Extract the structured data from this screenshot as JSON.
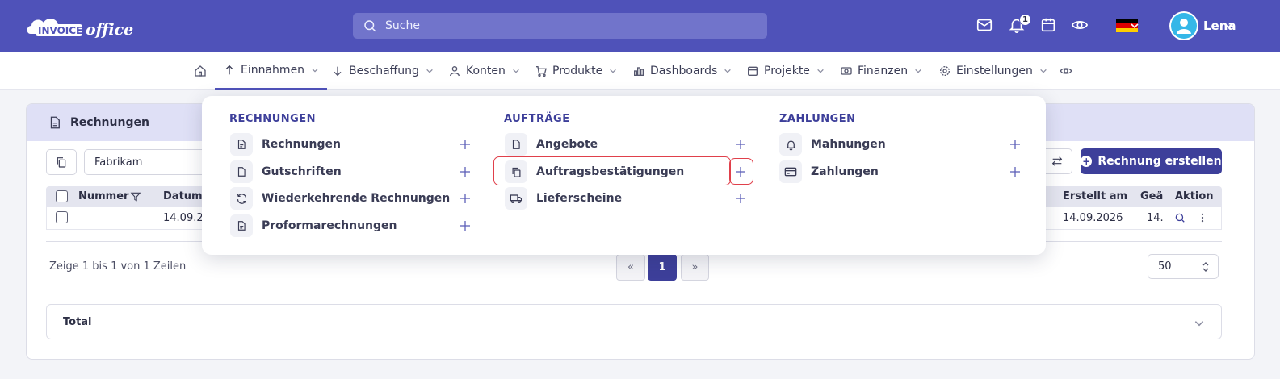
{
  "app": {
    "logo_left": "INVOICE",
    "logo_right": "office"
  },
  "search": {
    "placeholder": "Suche"
  },
  "header": {
    "notification_count": "1",
    "user_name": "Lena",
    "colors": {
      "primary": "#4f52b9",
      "accent": "#3d3f9a",
      "highlight": "#e0404b"
    }
  },
  "nav": {
    "items": [
      {
        "label": "Einnahmen",
        "icon": "arrow-up-icon"
      },
      {
        "label": "Beschaffung",
        "icon": "arrow-down-icon"
      },
      {
        "label": "Konten",
        "icon": "user-icon"
      },
      {
        "label": "Produkte",
        "icon": "cart-icon"
      },
      {
        "label": "Dashboards",
        "icon": "bar-chart-icon"
      },
      {
        "label": "Projekte",
        "icon": "calendar-icon"
      },
      {
        "label": "Finanzen",
        "icon": "banknote-icon"
      },
      {
        "label": "Einstellungen",
        "icon": "gear-icon"
      }
    ]
  },
  "card": {
    "title": "Rechnungen",
    "filter_value": "Fabrikam",
    "create_button": "Rechnung erstellen"
  },
  "table": {
    "columns": {
      "number": "Nummer",
      "date": "Datum",
      "created": "Erstellt am",
      "due": "Geä",
      "action": "Aktion"
    },
    "rows": [
      {
        "date": "14.09.2",
        "created": "14.09.2026",
        "due": "14."
      }
    ]
  },
  "footer": {
    "summary": "Zeige 1 bis 1 von 1 Zeilen",
    "prev": "«",
    "page": "1",
    "next": "»",
    "page_size": "50",
    "total_label": "Total"
  },
  "dropdown": {
    "columns": [
      {
        "heading": "RECHNUNGEN",
        "items": [
          "Rechnungen",
          "Gutschriften",
          "Wiederkehrende Rechnungen",
          "Proformarechnungen"
        ]
      },
      {
        "heading": "AUFTRÄGE",
        "items": [
          "Angebote",
          "Auftragsbestätigungen",
          "Lieferscheine"
        ]
      },
      {
        "heading": "ZAHLUNGEN",
        "items": [
          "Mahnungen",
          "Zahlungen"
        ]
      }
    ]
  }
}
